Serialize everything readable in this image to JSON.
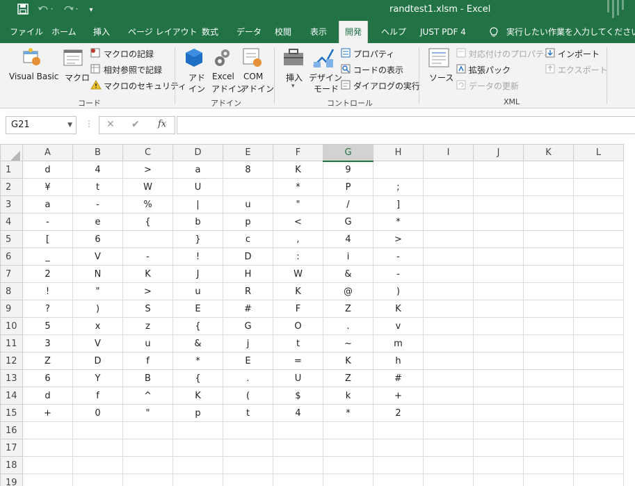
{
  "window": {
    "title": "randtest1.xlsm  -  Excel"
  },
  "qat": {
    "save_icon": "save-icon",
    "undo_icon": "undo-icon",
    "redo_icon": "redo-icon",
    "customize": "▾"
  },
  "tabs": [
    "ファイル",
    "ホーム",
    "挿入",
    "ページ レイアウト",
    "数式",
    "データ",
    "校閲",
    "表示",
    "開発",
    "ヘルプ",
    "JUST PDF 4",
    "実行したい作業を入力してください"
  ],
  "active_tab": "開発",
  "ribbon": {
    "code": {
      "group": "コード",
      "visual_basic": "Visual Basic",
      "macro": "マクロ",
      "record_macro": "マクロの記録",
      "relative_ref": "相対参照で記録",
      "macro_security": "マクロのセキュリティ"
    },
    "addins": {
      "group": "アドイン",
      "addin_l1": "アド",
      "addin_l2": "イン",
      "excel_addin_l1": "Excel",
      "excel_addin_l2": "アドイン",
      "com_addin_l1": "COM",
      "com_addin_l2": "アドイン"
    },
    "controls": {
      "group": "コントロール",
      "insert": "挿入",
      "design_l1": "デザイン",
      "design_l2": "モード",
      "properties": "プロパティ",
      "view_code": "コードの表示",
      "run_dialog": "ダイアログの実行"
    },
    "xml": {
      "group": "XML",
      "source": "ソース",
      "map_props": "対応付けのプロパティ",
      "expansion_packs": "拡張パック",
      "refresh_data": "データの更新",
      "import": "インポート",
      "export": "エクスポート"
    }
  },
  "formula_bar": {
    "name_box": "G21",
    "cancel": "✕",
    "enter": "✔",
    "fx": "fx",
    "value": ""
  },
  "sheet": {
    "selected_column": "G",
    "columns": [
      "A",
      "B",
      "C",
      "D",
      "E",
      "F",
      "G",
      "H",
      "I",
      "J",
      "K",
      "L"
    ],
    "rows": [
      [
        "d",
        "4",
        ">",
        "a",
        "8",
        "K",
        "9",
        "",
        "",
        "",
        "",
        ""
      ],
      [
        "¥",
        "t",
        "W",
        "U",
        "",
        "*",
        "P",
        ";",
        "",
        "",
        "",
        ""
      ],
      [
        "a",
        "-",
        "%",
        "|",
        "u",
        "\"",
        "/",
        "]",
        "",
        "",
        "",
        ""
      ],
      [
        "-",
        "e",
        "{",
        "b",
        "p",
        "<",
        "G",
        "*",
        "",
        "",
        "",
        ""
      ],
      [
        "[",
        "6",
        "",
        "}",
        "c",
        ",",
        "4",
        ">",
        "",
        "",
        "",
        ""
      ],
      [
        "_",
        "V",
        "-",
        "!",
        "D",
        ":",
        "i",
        "-",
        "",
        "",
        "",
        ""
      ],
      [
        "2",
        "N",
        "K",
        "J",
        "H",
        "W",
        "&",
        "-",
        "",
        "",
        "",
        ""
      ],
      [
        "!",
        "\"",
        ">",
        "u",
        "R",
        "K",
        "@",
        ")",
        "",
        "",
        "",
        ""
      ],
      [
        "?",
        ")",
        "S",
        "E",
        "#",
        "F",
        "Z",
        "K",
        "",
        "",
        "",
        ""
      ],
      [
        "5",
        "x",
        "z",
        "{",
        "G",
        "O",
        ".",
        "v",
        "",
        "",
        "",
        ""
      ],
      [
        "3",
        "V",
        "u",
        "&",
        "j",
        "t",
        "~",
        "m",
        "",
        "",
        "",
        ""
      ],
      [
        "Z",
        "D",
        "f",
        "*",
        "E",
        "=",
        "K",
        "h",
        "",
        "",
        "",
        ""
      ],
      [
        "6",
        "Y",
        "B",
        "{",
        ".",
        "U",
        "Z",
        "#",
        "",
        "",
        "",
        ""
      ],
      [
        "d",
        "f",
        "^",
        "K",
        "(",
        "$",
        "k",
        "+",
        "",
        "",
        "",
        ""
      ],
      [
        "+",
        "0",
        "\"",
        "p",
        "t",
        "4",
        "*",
        "2",
        "",
        "",
        "",
        ""
      ],
      [
        "",
        "",
        "",
        "",
        "",
        "",
        "",
        "",
        "",
        "",
        "",
        ""
      ],
      [
        "",
        "",
        "",
        "",
        "",
        "",
        "",
        "",
        "",
        "",
        "",
        ""
      ],
      [
        "",
        "",
        "",
        "",
        "",
        "",
        "",
        "",
        "",
        "",
        "",
        ""
      ],
      [
        "",
        "",
        "",
        "",
        "",
        "",
        "",
        "",
        "",
        "",
        "",
        ""
      ]
    ]
  },
  "colors": {
    "excel_green": "#217346",
    "ribbon_bg": "#f3f3f3",
    "grid_line": "#dadada"
  }
}
